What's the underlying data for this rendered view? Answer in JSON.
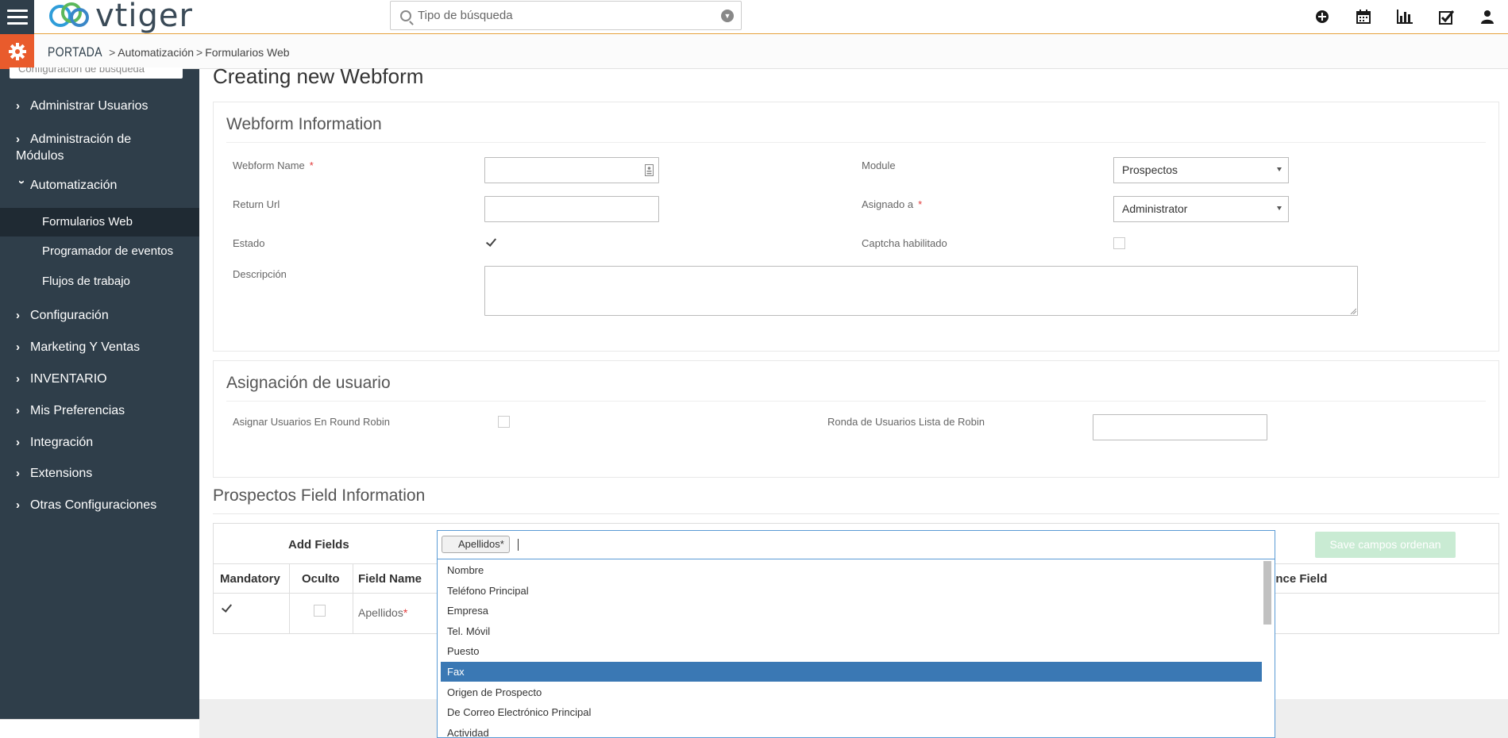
{
  "header": {
    "logo_text": "vtiger",
    "search_placeholder": "Tipo de búsqueda",
    "icons": [
      "plus-circle-icon",
      "calendar-icon",
      "bar-chart-icon",
      "check-square-icon",
      "user-icon"
    ]
  },
  "breadcrumb": {
    "home": "PORTADA",
    "sep": ">",
    "item1": "Automatización",
    "sep2": ">",
    "item2": "Formularios Web"
  },
  "sidebar": {
    "search_text": "Configuración de búsqueda",
    "items": {
      "users": "Administrar Usuarios",
      "modules": "Administración de Módulos",
      "automation": "Automatización",
      "webforms": "Formularios Web",
      "scheduler": "Programador de eventos",
      "workflows": "Flujos de trabajo",
      "config": "Configuración",
      "marketing": "Marketing Y Ventas",
      "inventory": "INVENTARIO",
      "prefs": "Mis Preferencias",
      "integration": "Integración",
      "extensions": "Extensions",
      "other": "Otras Configuraciones"
    }
  },
  "page": {
    "title": "Creating new Webform"
  },
  "webform_info": {
    "heading": "Webform Information",
    "name_label": "Webform Name",
    "required_mark": "*",
    "return_url_label": "Return Url",
    "estado_label": "Estado",
    "descripcion_label": "Descripción",
    "module_label": "Module",
    "module_value": "Prospectos",
    "assigned_label": "Asignado a",
    "assigned_value": "Administrator",
    "captcha_label": "Captcha habilitado"
  },
  "user_assign": {
    "heading": "Asignación de usuario",
    "round_robin_label": "Asignar Usuarios En Round Robin",
    "round_robin_list_label": "Ronda de Usuarios Lista de Robin"
  },
  "fields": {
    "heading": "Prospectos Field Information",
    "add_fields": "Add Fields",
    "save_btn": "Save campos ordenan",
    "col_mandatory": "Mandatory",
    "col_hidden": "Oculto",
    "col_field_name": "Field Name",
    "col_reference": "ence Field",
    "row_field": "Apellidos",
    "row_required": "*"
  },
  "dropdown": {
    "selected_tag": "Apellidos*",
    "options": [
      "Nombre",
      "Teléfono Principal",
      "Empresa",
      "Tel. Móvil",
      "Puesto",
      "Fax",
      "Origen de Prospecto",
      "De Correo Electrónico Principal",
      "Actividad"
    ],
    "highlighted": "Fax"
  },
  "colors": {
    "sidebar_bg": "#2f3e4a",
    "accent_orange": "#e95b2c",
    "highlight_blue": "#3a78b4",
    "save_btn_bg": "#c9ebd3"
  }
}
